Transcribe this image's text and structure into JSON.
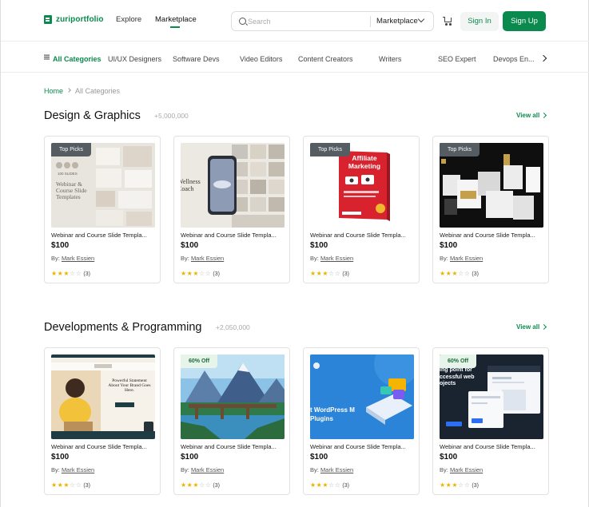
{
  "header": {
    "logo": "zuriportfolio",
    "nav": [
      "Explore",
      "Marketplace"
    ],
    "search_placeholder": "Search",
    "search_scope": "Marketplace",
    "sign_in": "Sign In",
    "sign_up": "Sign Up"
  },
  "categories": {
    "items": [
      "All Categories",
      "UI/UX Designers",
      "Software Devs",
      "Video Editors",
      "Content Creators",
      "Writers",
      "SEO Expert",
      "Devops En..."
    ]
  },
  "breadcrumb": {
    "home": "Home",
    "current": "All Categories"
  },
  "sections": [
    {
      "title": "Design & Graphics",
      "count": "+5,000,000",
      "view_all": "View all",
      "cards": [
        {
          "badge": "Top Picks",
          "title": "Webinar and Course Slide Templa...",
          "price": "$100",
          "by": "By:",
          "author": "Mark Essien",
          "stars": "★★★",
          "stars_off": "☆☆",
          "rating_count": "(3)",
          "thumb_text": "Webinar & Course Slide Templates"
        },
        {
          "badge": "",
          "title": "Webinar and Course Slide Templa...",
          "price": "$100",
          "by": "By:",
          "author": "Mark Essien",
          "stars": "★★★",
          "stars_off": "☆☆",
          "rating_count": "(3)",
          "thumb_text": "Wellness Coach"
        },
        {
          "badge": "Top Picks",
          "title": "Webinar and Course Slide Templa...",
          "price": "$100",
          "by": "By:",
          "author": "Mark Essien",
          "stars": "★★★",
          "stars_off": "☆☆",
          "rating_count": "(3)",
          "thumb_text": "Affiliate Marketing"
        },
        {
          "badge": "Top Picks",
          "title": "Webinar and Course Slide Templa...",
          "price": "$100",
          "by": "By:",
          "author": "Mark Essien",
          "stars": "★★★",
          "stars_off": "☆☆",
          "rating_count": "(3)",
          "thumb_text": ""
        }
      ]
    },
    {
      "title": "Developments & Programming",
      "count": "+2,050,000",
      "view_all": "View all",
      "cards": [
        {
          "badge": "",
          "title": "Webinar and Course Slide Templa...",
          "price": "$100",
          "by": "By:",
          "author": "Mark Essien",
          "stars": "★★★",
          "stars_off": "☆☆",
          "rating_count": "(3)",
          "thumb_text": "Powerful Statement About Your Brand Goes Here."
        },
        {
          "badge": "60% Off",
          "title": "Webinar and Course Slide Templa...",
          "price": "$100",
          "by": "By:",
          "author": "Mark Essien",
          "stars": "★★★",
          "stars_off": "☆☆",
          "rating_count": "(3)",
          "thumb_text": ""
        },
        {
          "badge": "",
          "title": "Webinar and Course Slide Templa...",
          "price": "$100",
          "by": "By:",
          "author": "Mark Essien",
          "stars": "★★★",
          "stars_off": "☆☆",
          "rating_count": "(3)",
          "thumb_text": "t WordPress M Plugins"
        },
        {
          "badge": "60% Off",
          "title": "Webinar and Course Slide Templa...",
          "price": "$100",
          "by": "By:",
          "author": "Mark Essien",
          "stars": "★★★",
          "stars_off": "☆☆",
          "rating_count": "(3)",
          "thumb_text": "ing point for ccessful web ojects"
        }
      ]
    }
  ],
  "colors": {
    "brand": "#0a8a4e",
    "badge_pick": "#555d62",
    "badge_off": "#e6f4ea",
    "star": "#e8b400"
  }
}
